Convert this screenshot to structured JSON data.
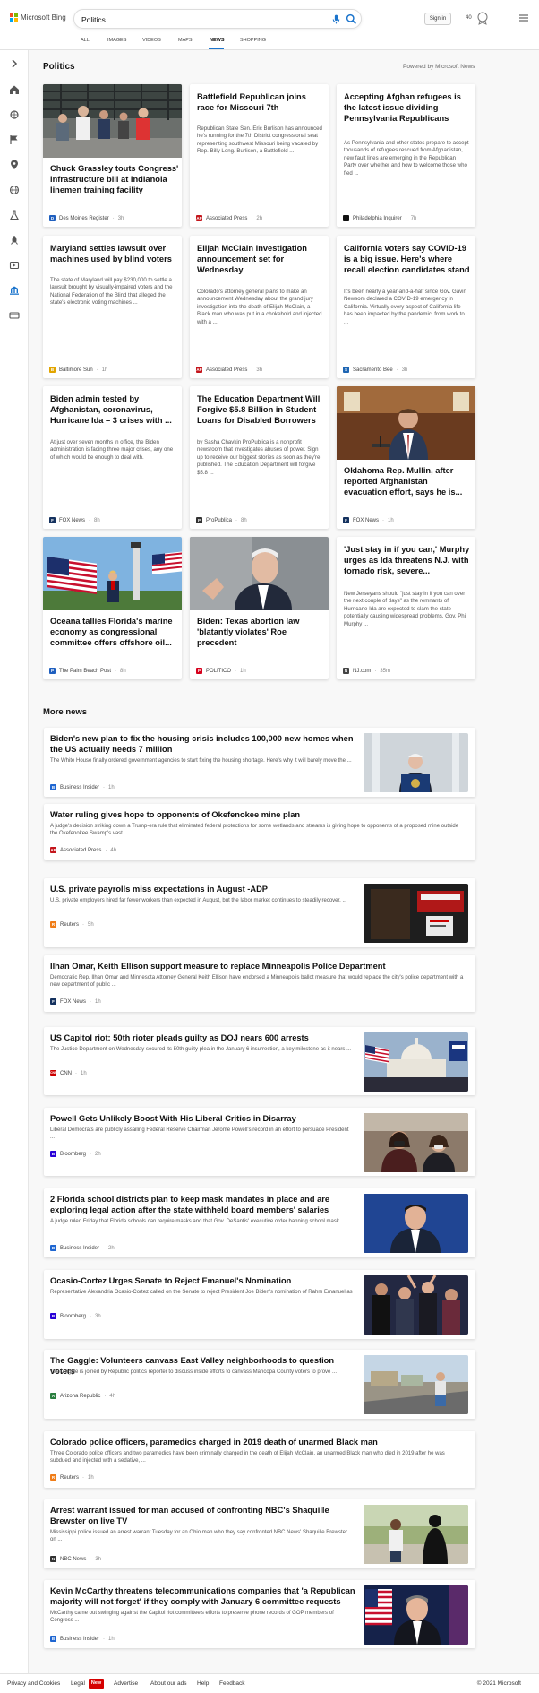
{
  "header": {
    "brand": "Microsoft Bing",
    "search_value": "Politics",
    "sign_in": "Sign in",
    "rewards_points": "40",
    "tabs": [
      {
        "label": "ALL"
      },
      {
        "label": "IMAGES"
      },
      {
        "label": "VIDEOS"
      },
      {
        "label": "MAPS"
      },
      {
        "label": "NEWS"
      },
      {
        "label": "SHOPPING"
      }
    ],
    "active_tab": "NEWS"
  },
  "sidebar": {
    "icons": [
      "chevron-right-icon",
      "home-icon",
      "sports-icon",
      "flag-icon",
      "location-icon",
      "globe-icon",
      "science-icon",
      "rocket-icon",
      "movie-icon",
      "government-icon",
      "money-icon"
    ]
  },
  "politics": {
    "title": "Politics",
    "powered_by": "Powered by Microsoft News",
    "cards": [
      {
        "title": "Chuck Grassley touts Congress' infrastructure bill at Indianola linemen training facility",
        "source": "Des Moines Register",
        "time": "3h",
        "favicon": "D",
        "favicon_color": "#1f5fbf",
        "image": "grassley-photo"
      },
      {
        "title": "Battlefield Republican joins race for Missouri 7th",
        "snippet": "Republican State Sen. Eric Burlison has announced he's running for the 7th District congressional seat representing southwest Missouri being vacated by Rep. Billy Long. Burlison, a Battlefield ...",
        "source": "Associated Press",
        "time": "2h",
        "favicon": "AP",
        "favicon_color": "#c4161c"
      },
      {
        "title": "Accepting Afghan refugees is the latest issue dividing Pennsylvania Republicans",
        "snippet": "As Pennsylvania and other states prepare to accept thousands of refugees rescued from Afghanistan, new fault lines are emerging in the Republican Party over whether and how to welcome those who fled ...",
        "source": "Philadelphia Inquirer",
        "time": "7h",
        "favicon": "I",
        "favicon_color": "#111111"
      },
      {
        "title": "Maryland settles lawsuit over machines used by blind voters",
        "snippet": "The state of Maryland will pay $230,000 to settle a lawsuit brought by visually-impaired voters and the National Federation of the Blind that alleged the state's electronic voting machines ...",
        "source": "Baltimore Sun",
        "time": "1h",
        "favicon": "B",
        "favicon_color": "#e2a500"
      },
      {
        "title": "Elijah McClain investigation announcement set for Wednesday",
        "snippet": "Colorado's attorney general plans to make an announcement Wednesday about the grand jury investigation into the death of Elijah McClain, a Black man who was put in a chokehold and injected with a ...",
        "source": "Associated Press",
        "time": "3h",
        "favicon": "AP",
        "favicon_color": "#c4161c"
      },
      {
        "title": "California voters say COVID-19 is a big issue. Here's where recall election candidates stand",
        "snippet": "It's been nearly a year-and-a-half since Gov. Gavin Newsom declared a COVID-19 emergency in California. Virtually every aspect of California life has been impacted by the pandemic, from work to ...",
        "source": "Sacramento Bee",
        "time": "3h",
        "favicon": "S",
        "favicon_color": "#1f66b3"
      },
      {
        "title": "Biden admin tested by Afghanistan, coronavirus, Hurricane Ida – 3 crises with ...",
        "snippet": "At just over seven months in office, the Biden administration is facing three major crises, any one of which would be enough to deal with.",
        "source": "FOX News",
        "time": "8h",
        "favicon": "F",
        "favicon_color": "#15325f"
      },
      {
        "title": "The Education Department Will Forgive $5.8 Billion in Student Loans for Disabled Borrowers",
        "snippet": "by Sasha Chavkin ProPublica is a nonprofit newsroom that investigates abuses of power. Sign up to receive our biggest stories as soon as they're published. The Education Department will forgive $5.8 ...",
        "source": "ProPublica",
        "time": "8h",
        "favicon": "P",
        "favicon_color": "#333333"
      },
      {
        "title": "Oklahoma Rep. Mullin, after reported Afghanistan evacuation effort, says he is...",
        "source": "FOX News",
        "time": "1h",
        "favicon": "F",
        "favicon_color": "#15325f",
        "image": "mullin-photo"
      },
      {
        "title": "Oceana tallies Florida's marine economy as congressional committee offers offshore oil...",
        "source": "The Palm Beach Post",
        "time": "8h",
        "favicon": "P",
        "favicon_color": "#1f5fbf",
        "image": "flags-photo"
      },
      {
        "title": "Biden: Texas abortion law 'blatantly violates' Roe precedent",
        "source": "POLITICO",
        "time": "1h",
        "favicon": "P",
        "favicon_color": "#d6001c",
        "image": "biden-photo"
      },
      {
        "title": "'Just stay in if you can,' Murphy urges as Ida threatens N.J. with tornado risk, severe...",
        "snippet": "New Jerseyans should \"just stay in if you can over the next couple of days\" as the remnants of Hurricane Ida are expected to slam the state potentially causing widespread problems, Gov. Phil Murphy ...",
        "source": "NJ.com",
        "time": "35m",
        "favicon": "N",
        "favicon_color": "#444444"
      }
    ]
  },
  "more_news": {
    "title": "More news",
    "items": [
      {
        "title": "Biden's new plan to fix the housing crisis includes 100,000 new homes when the US actually needs 7 million",
        "snippet": "The White House finally ordered government agencies to start fixing the housing shortage. Here's why it will barely move the ...",
        "source": "Business Insider",
        "time": "1h",
        "favicon": "B",
        "favicon_color": "#1f66d1",
        "image": "podium-photo"
      },
      {
        "title": "Water ruling gives hope to opponents of Okefenokee mine plan",
        "snippet": "A judge's decision striking down a Trump-era rule that eliminated federal protections for some wetlands and streams is giving hope to opponents of a proposed mine outside the Okefenokee Swamp's vast ...",
        "source": "Associated Press",
        "time": "4h",
        "favicon": "AP",
        "favicon_color": "#c4161c"
      },
      {
        "title": "U.S. private payrolls miss expectations in August -ADP",
        "snippet": "U.S. private employers hired far fewer workers than expected in August, but the labor market continues to steadily recover. ...",
        "source": "Reuters",
        "time": "5h",
        "favicon": "R",
        "favicon_color": "#f07d18",
        "image": "shop-photo"
      },
      {
        "title": "Ilhan Omar, Keith Ellison support measure to replace Minneapolis Police Department",
        "snippet": "Democratic Rep. Ilhan Omar and Minnesota Attorney General Keith Ellison have endorsed a Minneapolis ballot measure that would replace the city's police department with a new department of public ...",
        "source": "FOX News",
        "time": "1h",
        "favicon": "F",
        "favicon_color": "#15325f"
      },
      {
        "title": "US Capitol riot: 50th rioter pleads guilty as DOJ nears 600 arrests",
        "snippet": "The Justice Department on Wednesday secured its 50th guilty plea in the January 6 insurrection, a key milestone as it nears ...",
        "source": "CNN",
        "time": "1h",
        "favicon": "CNN",
        "favicon_color": "#cc0000",
        "image": "capitol-photo"
      },
      {
        "title": "Powell Gets Unlikely Boost With His Liberal Critics in Disarray",
        "snippet": "Liberal Democrats are publicly assailing Federal Reserve Chairman Jerome Powell's record in an effort to persuade President ...",
        "source": "Bloomberg",
        "time": "2h",
        "favicon": "B",
        "favicon_color": "#2800d7",
        "image": "masks-photo"
      },
      {
        "title": "2 Florida school districts plan to keep mask mandates in place and are exploring legal action after the state withheld board members' salaries",
        "snippet": "A judge ruled Friday that Florida schools can require masks and that Gov. DeSantis' executive order banning school mask ...",
        "source": "Business Insider",
        "time": "2h",
        "favicon": "B",
        "favicon_color": "#1f66d1",
        "image": "desantis-photo"
      },
      {
        "title": "Ocasio-Cortez Urges Senate to Reject Emanuel's Nomination",
        "snippet": "Representative Alexandria Ocasio-Cortez called on the Senate to reject President Joe Biden's nomination of Rahm Emanuel as ...",
        "source": "Bloomberg",
        "time": "3h",
        "favicon": "B",
        "favicon_color": "#2800d7",
        "image": "crowd-photo"
      },
      {
        "title": "The Gaggle: Volunteers canvass East Valley neighborhoods to question voters",
        "snippet": "The Gaggle is joined by Republic politics reporter to discuss inside efforts to canvass Maricopa County voters to prove ...",
        "source": "Arizona Republic",
        "time": "4h",
        "favicon": "A",
        "favicon_color": "#2a7f3f",
        "image": "street-photo"
      },
      {
        "title": "Colorado police officers, paramedics charged in 2019 death of unarmed Black man",
        "snippet": "Three Colorado police officers and two paramedics have been criminally charged in the death of Elijah McClain, an unarmed Black man who died in 2019 after he was subdued and injected with a sedative, ...",
        "source": "Reuters",
        "time": "1h",
        "favicon": "R",
        "favicon_color": "#f07d18"
      },
      {
        "title": "Arrest warrant issued for man accused of confronting NBC's Shaquille Brewster on live TV",
        "snippet": "Mississippi police issued an arrest warrant Tuesday for an Ohio man who they say confronted NBC News' Shaquille Brewster on ...",
        "source": "NBC News",
        "time": "3h",
        "favicon": "N",
        "favicon_color": "#333333",
        "image": "reporter-photo"
      },
      {
        "title": "Kevin McCarthy threatens telecommunications companies that 'a Republican majority will not forget' if they comply with January 6 committee requests",
        "snippet": "McCarthy came out swinging against the Capitol riot committee's efforts to preserve phone records of GOP members of Congress ...",
        "source": "Business Insider",
        "time": "1h",
        "favicon": "B",
        "favicon_color": "#1f66d1",
        "image": "mccarthy-photo"
      }
    ]
  },
  "footer": {
    "links": [
      "Privacy and Cookies",
      "Legal",
      "Advertise",
      "About our ads",
      "Help",
      "Feedback"
    ],
    "new_badge": "New",
    "copyright": "© 2021 Microsoft"
  },
  "colors": {
    "accent": "#1b74cc",
    "bing_red": "#f25022",
    "bing_green": "#7fba00",
    "bing_blue": "#00a4ef",
    "bing_yellow": "#ffb900"
  }
}
